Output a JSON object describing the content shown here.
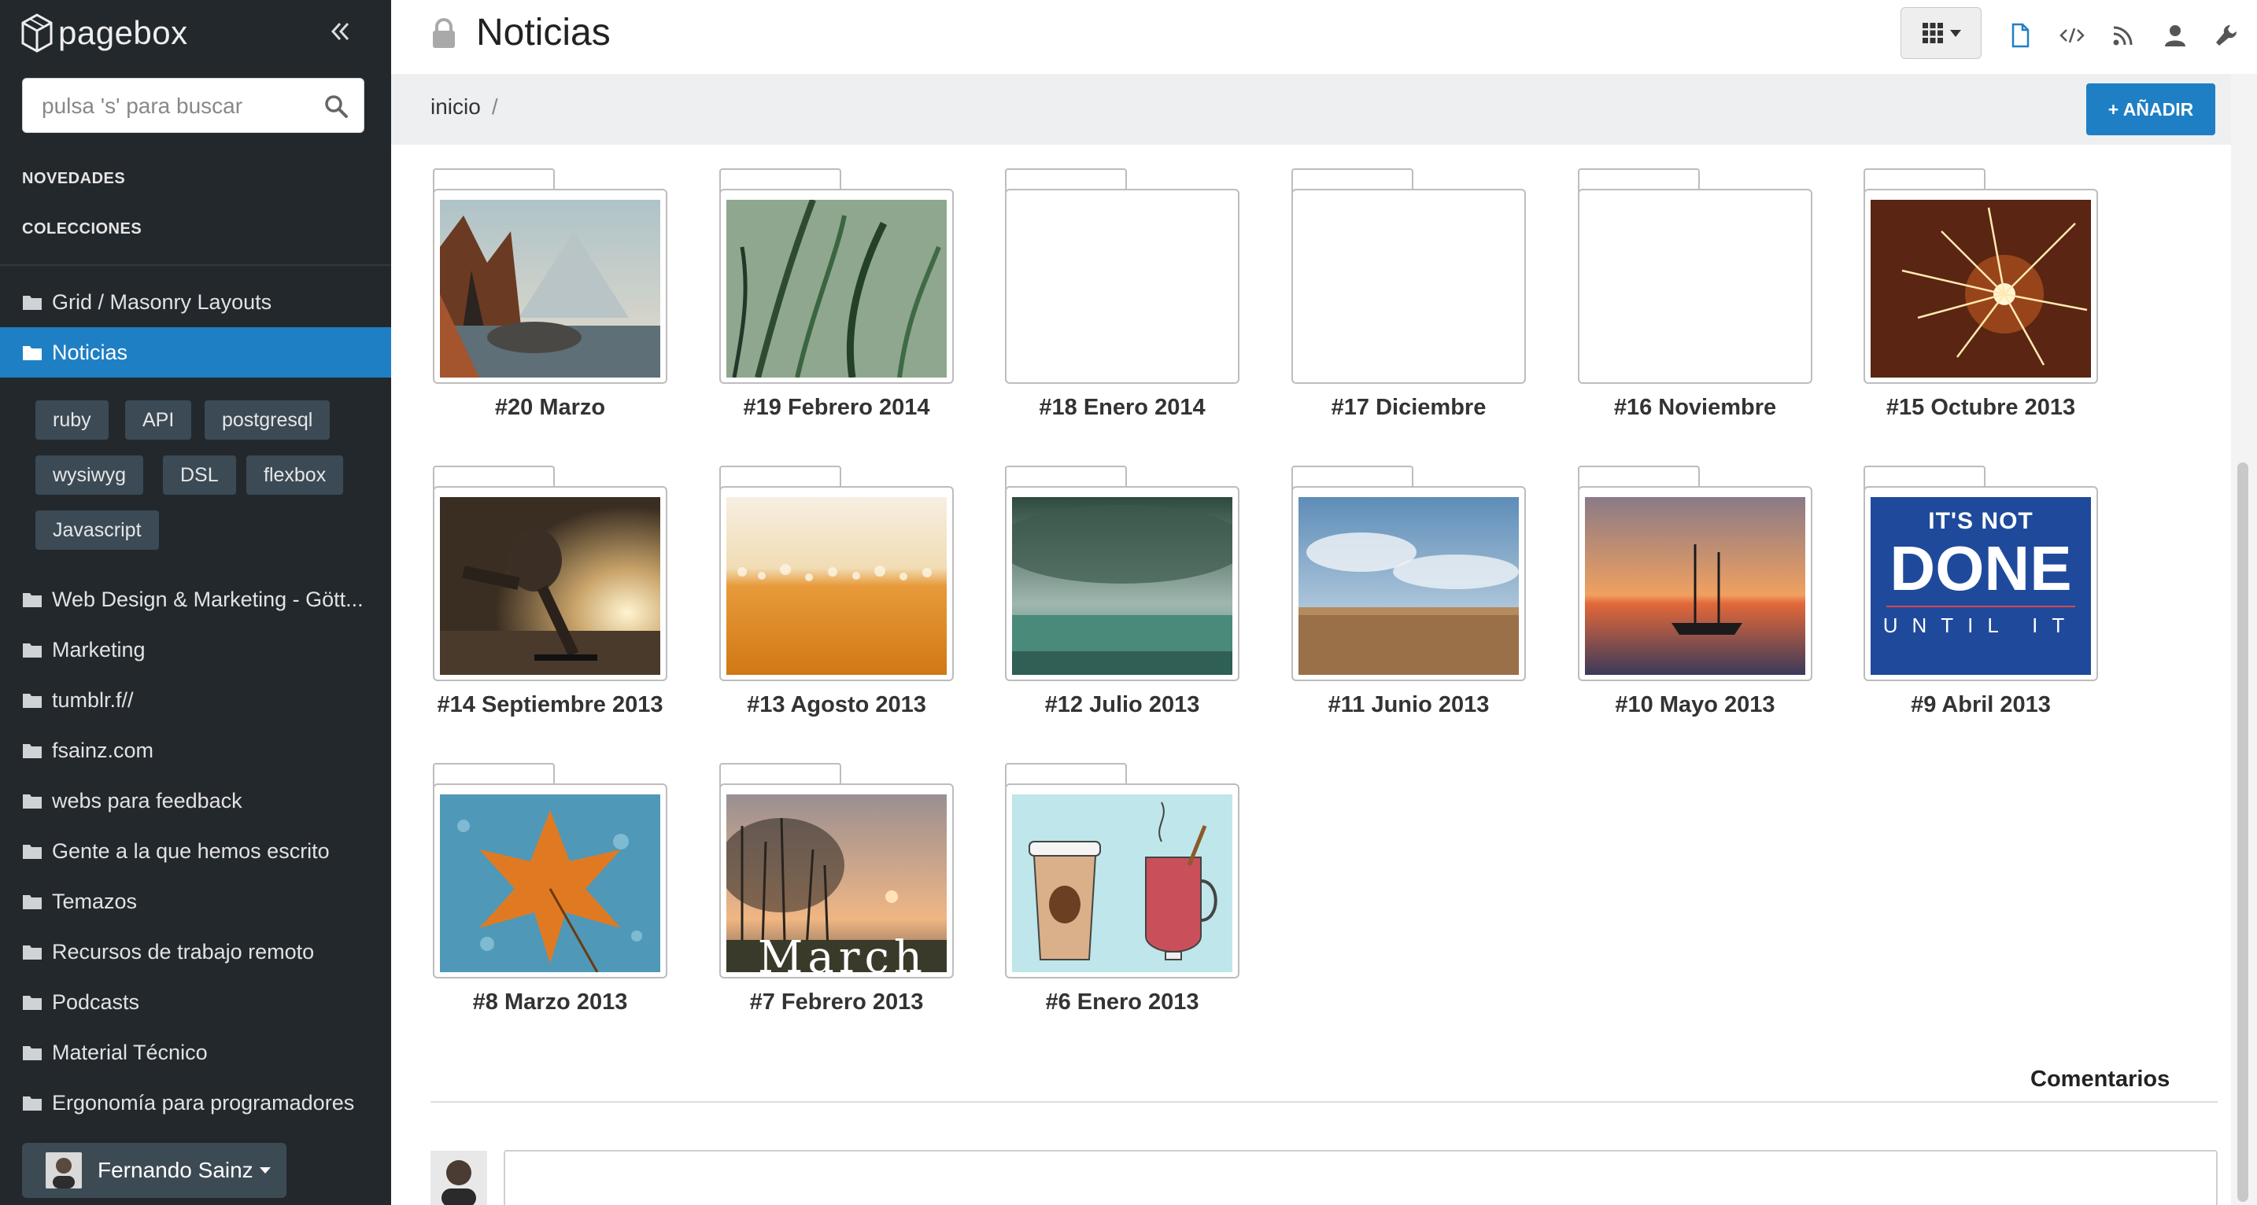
{
  "app": {
    "brand": "pagebox"
  },
  "sidebar": {
    "search_placeholder": "pulsa 's' para buscar",
    "sections": {
      "novedades": "NOVEDADES",
      "colecciones": "COLECCIONES"
    },
    "items": [
      {
        "label": "Grid / Masonry Layouts",
        "active": false
      },
      {
        "label": "Noticias",
        "active": true
      },
      {
        "label": "Web Design & Marketing - Gött...",
        "active": false
      },
      {
        "label": "Marketing",
        "active": false
      },
      {
        "label": "tumblr.f//",
        "active": false
      },
      {
        "label": "fsainz.com",
        "active": false
      },
      {
        "label": "webs para feedback",
        "active": false
      },
      {
        "label": "Gente a la que hemos escrito",
        "active": false
      },
      {
        "label": "Temazos",
        "active": false
      },
      {
        "label": "Recursos de trabajo remoto",
        "active": false
      },
      {
        "label": "Podcasts",
        "active": false
      },
      {
        "label": "Material Técnico",
        "active": false
      },
      {
        "label": "Ergonomía para programadores",
        "active": false
      }
    ],
    "tags": [
      "ruby",
      "API",
      "postgresql",
      "wysiwyg",
      "DSL",
      "flexbox",
      "Javascript"
    ],
    "user": {
      "name": "Fernando Sainz"
    }
  },
  "header": {
    "title": "Noticias",
    "icons": [
      "grid-view-icon",
      "document-icon",
      "code-icon",
      "rss-icon",
      "user-icon",
      "wrench-icon"
    ]
  },
  "breadcrumb": {
    "root": "inicio",
    "separator": "/"
  },
  "actions": {
    "add_label": "+ AÑADIR"
  },
  "folders": [
    {
      "label": "#20 Marzo",
      "thumb": "autumn-forest-lake"
    },
    {
      "label": "#19 Febrero 2014",
      "thumb": "green-grass"
    },
    {
      "label": "#18 Enero 2014",
      "thumb": "empty"
    },
    {
      "label": "#17 Diciembre",
      "thumb": "empty"
    },
    {
      "label": "#16 Noviembre",
      "thumb": "empty"
    },
    {
      "label": "#15 Octubre 2013",
      "thumb": "sparkler"
    },
    {
      "label": "#14 Septiembre 2013",
      "thumb": "skateboarder"
    },
    {
      "label": "#13 Agosto 2013",
      "thumb": "beer"
    },
    {
      "label": "#12 Julio 2013",
      "thumb": "stormy-sea"
    },
    {
      "label": "#11 Junio 2013",
      "thumb": "wheat-field"
    },
    {
      "label": "#10 Mayo 2013",
      "thumb": "sunset-boat"
    },
    {
      "label": "#9 Abril 2013",
      "thumb": "poster-text",
      "poster": {
        "line1": "IT'S NOT",
        "line2": "DONE",
        "line3": "UNTIL IT"
      }
    },
    {
      "label": "#8 Marzo 2013",
      "thumb": "autumn-leaf-rain"
    },
    {
      "label": "#7 Febrero 2013",
      "thumb": "sunset-trees",
      "overlay_text": "March"
    },
    {
      "label": "#6 Enero 2013",
      "thumb": "coffee-cups"
    }
  ],
  "comments": {
    "title": "Comentarios"
  },
  "colors": {
    "sidebar_bg": "#23282d",
    "accent": "#1f7fc4",
    "breadbar_bg": "#eeeff1"
  }
}
